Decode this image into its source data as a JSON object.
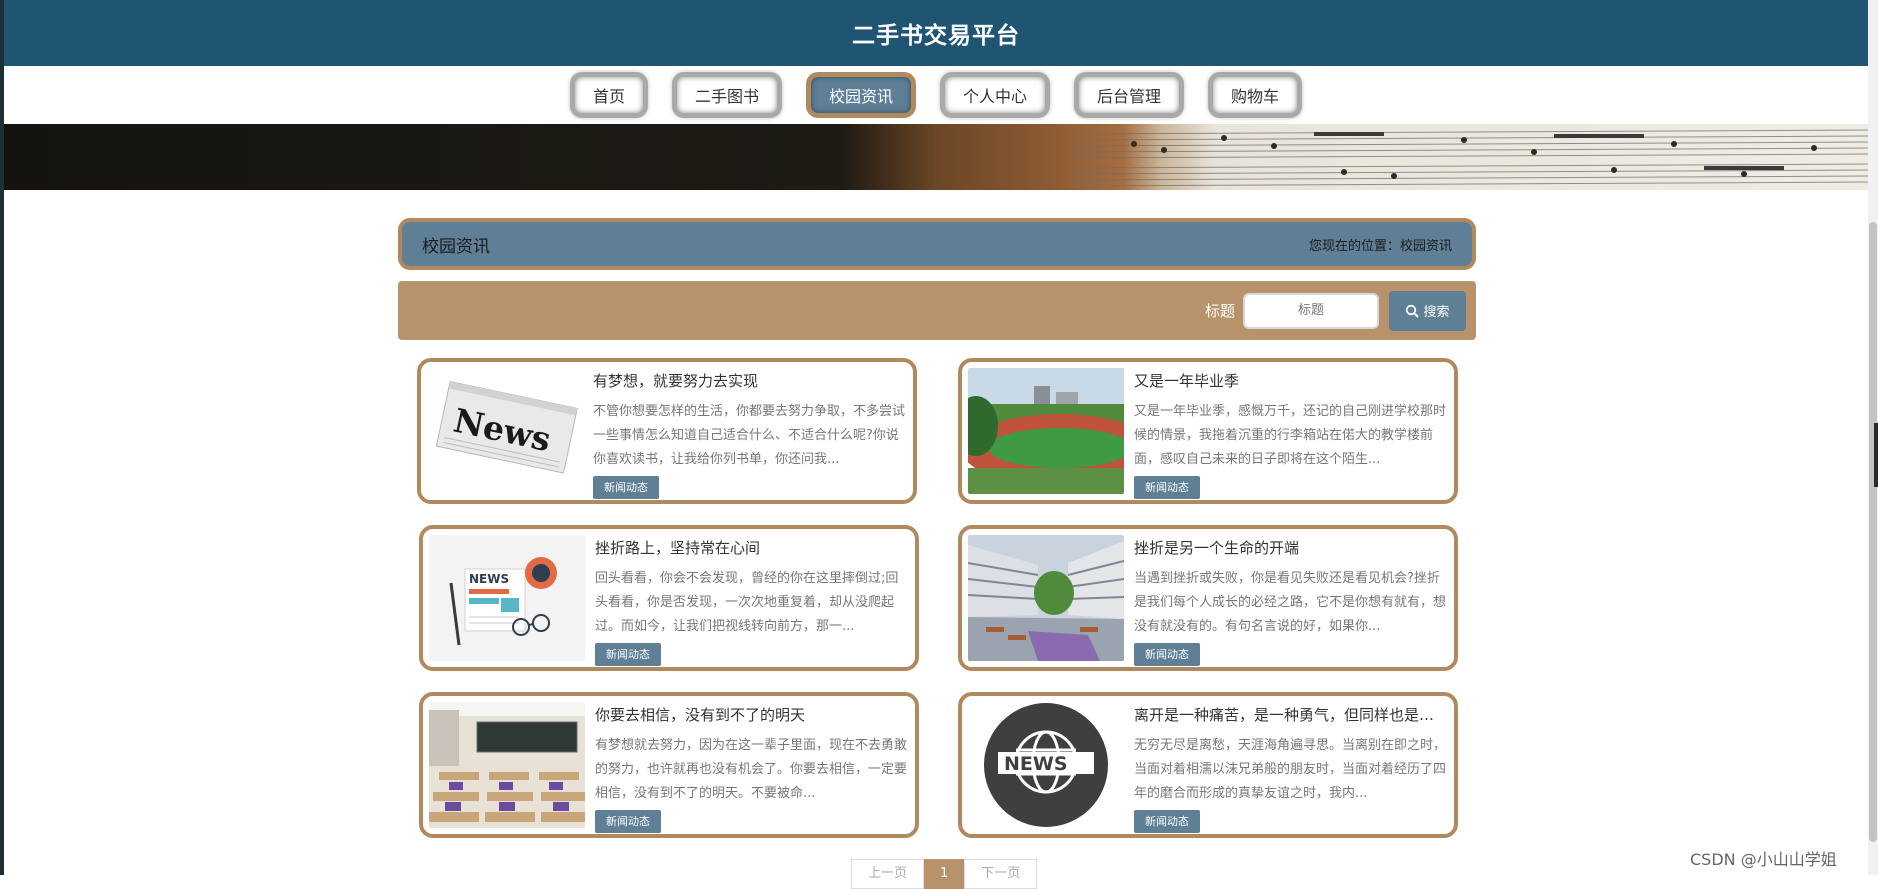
{
  "header": {
    "title": "二手书交易平台"
  },
  "nav": [
    {
      "label": "首页",
      "active": false
    },
    {
      "label": "二手图书",
      "active": false
    },
    {
      "label": "校园资讯",
      "active": true
    },
    {
      "label": "个人中心",
      "active": false
    },
    {
      "label": "后台管理",
      "active": false
    },
    {
      "label": "购物车",
      "active": false
    }
  ],
  "section": {
    "title": "校园资讯",
    "breadcrumb": "您现在的位置：校园资讯"
  },
  "search": {
    "label": "标题",
    "placeholder": "标题",
    "button": "搜索"
  },
  "cards": [
    {
      "title": "有梦想，就要努力去实现",
      "desc": "不管你想要怎样的生活，你都要去努力争取，不多尝试一些事情怎么知道自己适合什么、不适合什么呢?你说你喜欢读书，让我给你列书单，你还问我...",
      "tag": "新闻动态",
      "image": "news-newspaper-image"
    },
    {
      "title": "又是一年毕业季",
      "desc": "又是一年毕业季，感慨万千，还记的自己刚进学校那时候的情景，我拖着沉重的行李箱站在偌大的教学楼前面，感叹自己未来的日子即将在这个陌生...",
      "tag": "新闻动态",
      "image": "campus-track-image"
    },
    {
      "title": "挫折路上，坚持常在心间",
      "desc": "回头看看，你会不会发现，曾经的你在这里摔倒过;回头看看，你是否发现，一次次地重复着，却从没爬起过。而如今，让我们把视线转向前方，那一...",
      "tag": "新闻动态",
      "image": "news-document-image"
    },
    {
      "title": "挫折是另一个生命的开端",
      "desc": "当遇到挫折或失败，你是看见失败还是看见机会?挫折是我们每个人成长的必经之路，它不是你想有就有，想没有就没有的。有句名言说的好，如果你...",
      "tag": "新闻动态",
      "image": "campus-building-image"
    },
    {
      "title": "你要去相信，没有到不了的明天",
      "desc": "有梦想就去努力，因为在这一辈子里面，现在不去勇敢的努力，也许就再也没有机会了。你要去相信，一定要相信，没有到不了的明天。不要被命...",
      "tag": "新闻动态",
      "image": "classroom-image"
    },
    {
      "title": "离开是一种痛苦，是一种勇气，但同样也是一个考验",
      "desc": "无穷无尽是离愁，天涯海角遍寻思。当离别在即之时，当面对着相濡以沫兄弟般的朋友时，当面对着经历了四年的磨合而形成的真挚友谊之时，我内...",
      "tag": "新闻动态",
      "image": "news-globe-image"
    }
  ],
  "pagination": {
    "prev": "上一页",
    "current": "1",
    "next": "下一页"
  },
  "watermark": "CSDN @小山山学姐",
  "colors": {
    "header": "#1f5473",
    "accent": "#5e7f96",
    "tan": "#b8926a",
    "border": "#b08a5e"
  }
}
